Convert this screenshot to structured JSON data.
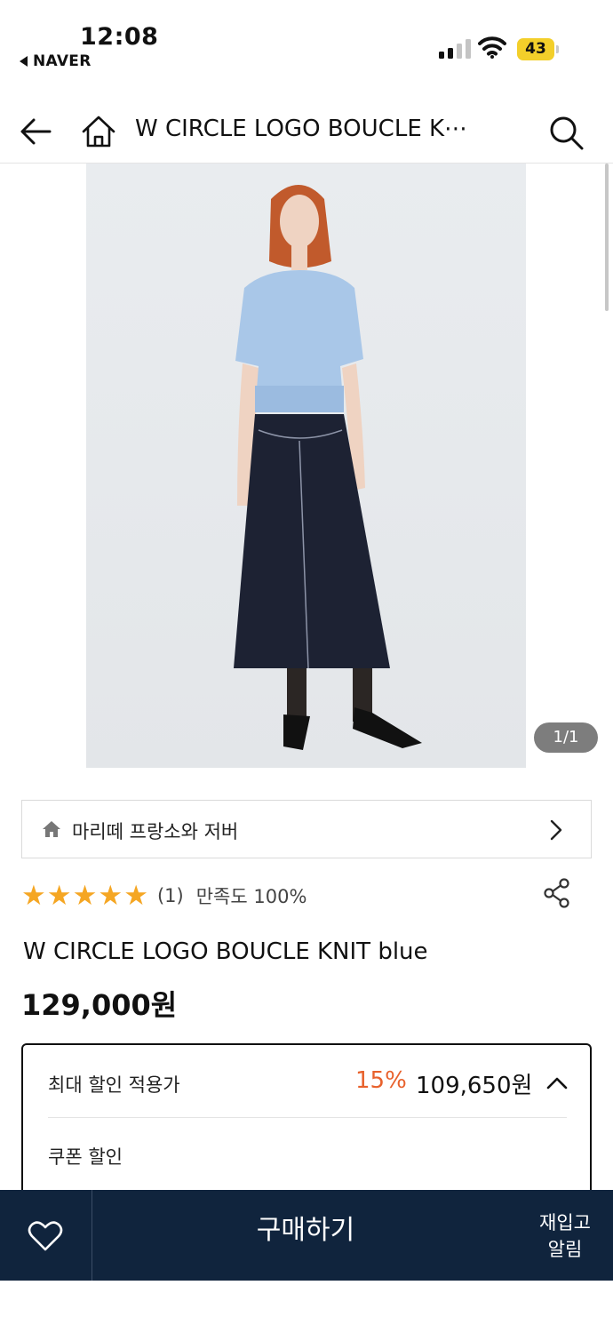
{
  "status_bar": {
    "time": "12:08",
    "back_app": "NAVER",
    "battery": "43"
  },
  "header": {
    "title": "W CIRCLE LOGO BOUCLE K⋯",
    "icons": [
      "back-arrow-icon",
      "home-icon",
      "search-icon"
    ]
  },
  "gallery": {
    "counter": "1/1"
  },
  "store": {
    "name": "마리떼 프랑소와 저버",
    "icon": "home-icon"
  },
  "rating": {
    "stars": 5,
    "star_color": "#f5a623",
    "review_count": "(1)",
    "satisfaction": "만족도 100%"
  },
  "product": {
    "name": "W CIRCLE LOGO BOUCLE KNIT blue",
    "price": "129,000원"
  },
  "discount": {
    "label": "최대 할인 적용가",
    "percent": "15%",
    "percent_color": "#e8612c",
    "price": "109,650원",
    "coupon_label": "쿠폰 할인"
  },
  "bottom_bar": {
    "background": "#10243d",
    "buy_label": "구매하기",
    "restock_line1": "재입고",
    "restock_line2": "알림"
  }
}
